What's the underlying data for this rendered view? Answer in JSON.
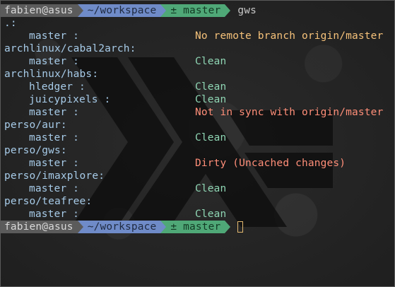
{
  "prompt": {
    "user_host": "fabien@asus",
    "directory": "~/workspace",
    "branch": "± master",
    "command": "gws"
  },
  "output": {
    "root": ".:",
    "root_master_key": "master :",
    "root_master_status": "No remote branch origin/master",
    "g1": "archlinux/cabal2arch:",
    "g1_master_key": "master :",
    "g1_master_status": "Clean",
    "g2": "archlinux/habs:",
    "g2_hledger_key": "hledger :",
    "g2_hledger_status": "Clean",
    "g2_juicy_key": "juicypixels :",
    "g2_juicy_status": "Clean",
    "g2_master_key": "master :",
    "g2_master_status": "Not in sync with origin/master",
    "g3": "perso/aur:",
    "g3_master_key": "master :",
    "g3_master_status": "Clean",
    "g4": "perso/gws:",
    "g4_master_key": "master :",
    "g4_master_status": "Dirty (Uncached changes)",
    "g5": "perso/imaxplore:",
    "g5_master_key": "master :",
    "g5_master_status": "Clean",
    "g6": "perso/teafree:",
    "g6_master_key": "master :",
    "g6_master_status": "Clean"
  },
  "colors": {
    "clean": "#8fd6b4",
    "warning": "#f6c27a",
    "error": "#ff8e78",
    "path": "#a7cbe8"
  }
}
